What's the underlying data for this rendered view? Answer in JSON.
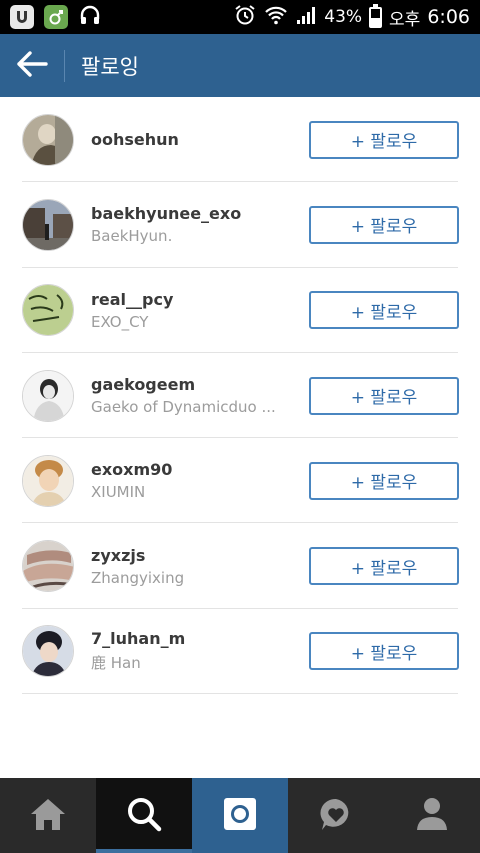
{
  "status_bar": {
    "battery_percent": "43%",
    "ampm": "오후",
    "time": "6:06",
    "battery_level": 0.43
  },
  "header": {
    "title": "팔로잉"
  },
  "follow_button_label": "+ 팔로우",
  "users": [
    {
      "username": "oohsehun",
      "full_name": ""
    },
    {
      "username": "baekhyunee_exo",
      "full_name": "BaekHyun."
    },
    {
      "username": "real__pcy",
      "full_name": "EXO_CY"
    },
    {
      "username": "gaekogeem",
      "full_name": "Gaeko of Dynamicduo ..."
    },
    {
      "username": "exoxm90",
      "full_name": "XIUMIN"
    },
    {
      "username": "zyxzjs",
      "full_name": "Zhangyixing"
    },
    {
      "username": "7_luhan_m",
      "full_name": "鹿 Han"
    }
  ],
  "bottom_nav": {
    "items": [
      "home-icon",
      "search-icon",
      "camera-icon",
      "activity-icon",
      "profile-icon"
    ],
    "active": "search-icon"
  },
  "colors": {
    "header_bg": "#2e6190",
    "accent": "#4a86c0",
    "nav_bg": "#2a2a2a"
  }
}
